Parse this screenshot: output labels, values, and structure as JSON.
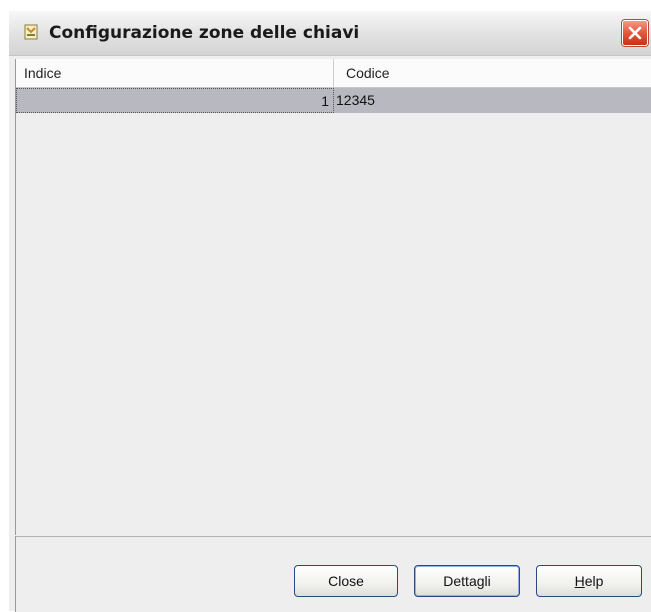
{
  "window": {
    "title": "Configurazione zone delle chiavi",
    "icon": "app-icon",
    "close_icon": "close-icon"
  },
  "table": {
    "columns": [
      "Indice",
      "Codice"
    ],
    "rows": [
      {
        "indice": "1",
        "codice": "12345"
      }
    ]
  },
  "buttons": {
    "close_label": "Close",
    "dettagli_label": "Dettagli",
    "help_mnemonic": "H",
    "help_rest": "elp"
  },
  "colors": {
    "selected_row": "#b8b8c0",
    "close_button": "#e4563a",
    "button_border": "#2b4a7c"
  }
}
